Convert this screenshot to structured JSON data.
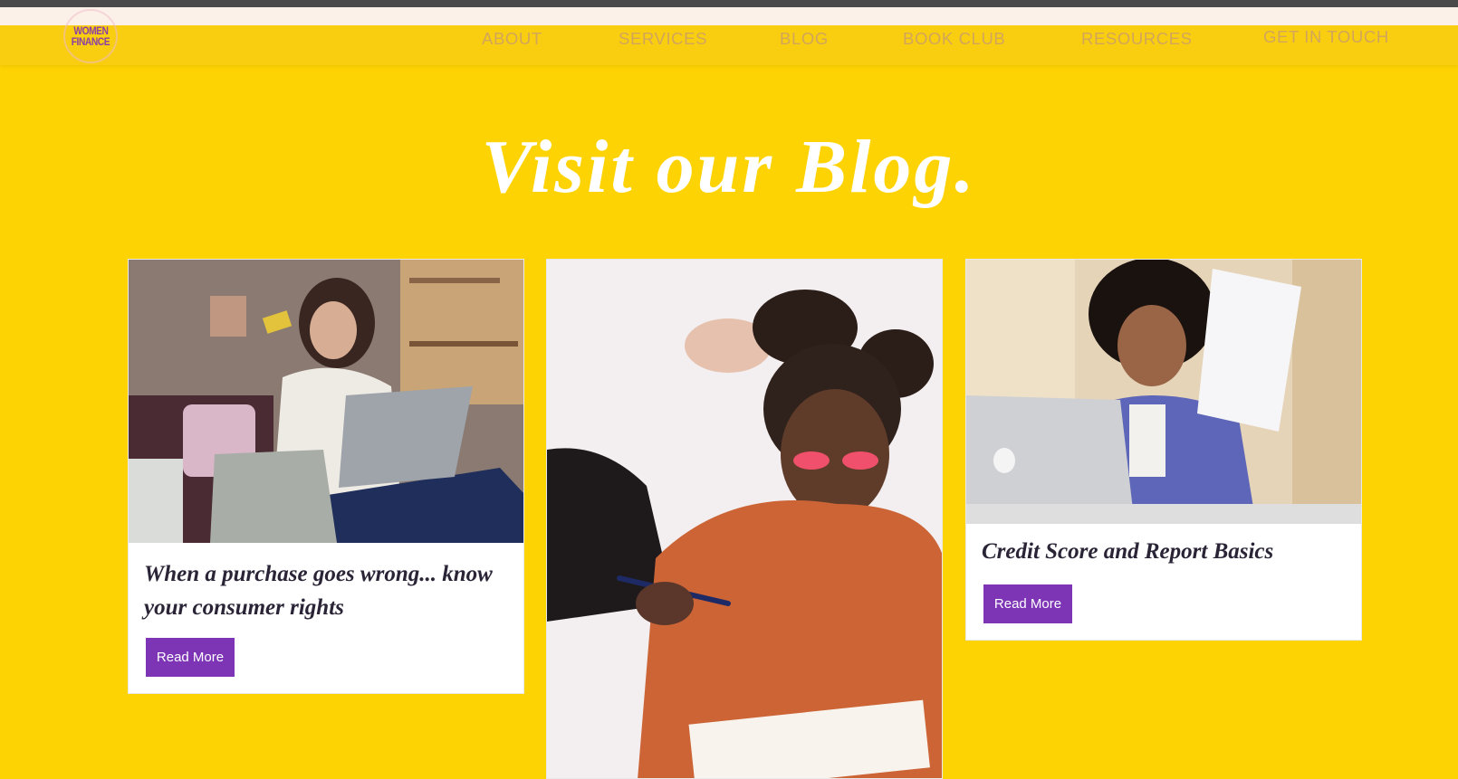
{
  "brand": {
    "logo_line1": "WOMEN",
    "logo_line2": "FINANCE"
  },
  "nav": {
    "items": [
      "ABOUT",
      "SERVICES",
      "BLOG",
      "BOOK CLUB",
      "RESOURCES",
      "GET IN TOUCH"
    ]
  },
  "hero": {
    "title": "Visit our Blog."
  },
  "posts": [
    {
      "title": "When a purchase goes wrong... know your consumer rights",
      "cta": "Read More"
    },
    {
      "title": "",
      "cta": ""
    },
    {
      "title": "Credit Score and Report Basics",
      "cta": "Read More"
    }
  ],
  "colors": {
    "page_bg": "#fed303",
    "nav_bg": "#f9cd10",
    "nav_text": "#d2a65a",
    "button": "#7d35b6",
    "logo": "#8a3fa6"
  }
}
